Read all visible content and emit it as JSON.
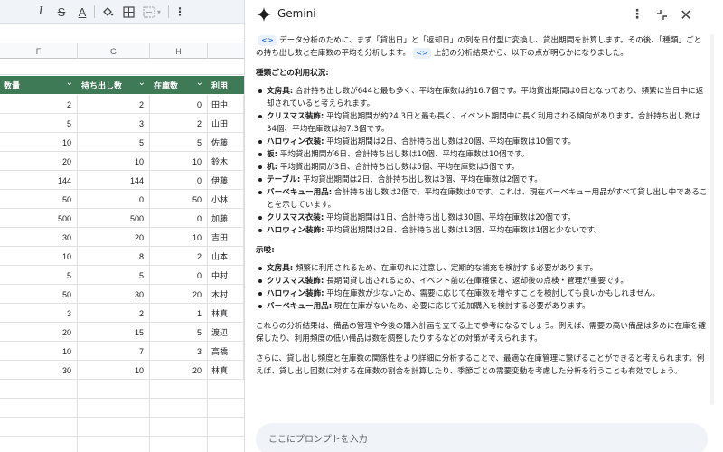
{
  "sheet": {
    "toolbar": {
      "icons": [
        "italic-icon",
        "strikethrough-icon",
        "text-color-icon",
        "fill-color-icon",
        "borders-icon",
        "merge-cells-icon",
        "more-vert-icon"
      ]
    },
    "columns": [
      "F",
      "G",
      "H",
      ""
    ],
    "headers": [
      "数量",
      "持ち出し数",
      "在庫数",
      "利用"
    ],
    "rows": [
      {
        "qty": "2",
        "out": "2",
        "stock": "0",
        "user": "田中"
      },
      {
        "qty": "5",
        "out": "3",
        "stock": "2",
        "user": "山田"
      },
      {
        "qty": "10",
        "out": "5",
        "stock": "5",
        "user": "佐藤"
      },
      {
        "qty": "20",
        "out": "10",
        "stock": "10",
        "user": "鈴木"
      },
      {
        "qty": "144",
        "out": "144",
        "stock": "0",
        "user": "伊藤"
      },
      {
        "qty": "50",
        "out": "0",
        "stock": "50",
        "user": "小林"
      },
      {
        "qty": "500",
        "out": "500",
        "stock": "0",
        "user": "加藤"
      },
      {
        "qty": "30",
        "out": "20",
        "stock": "10",
        "user": "吉田"
      },
      {
        "qty": "10",
        "out": "8",
        "stock": "2",
        "user": "山本"
      },
      {
        "qty": "5",
        "out": "5",
        "stock": "0",
        "user": "中村"
      },
      {
        "qty": "50",
        "out": "30",
        "stock": "20",
        "user": "木村"
      },
      {
        "qty": "3",
        "out": "2",
        "stock": "1",
        "user": "林真"
      },
      {
        "qty": "20",
        "out": "15",
        "stock": "5",
        "user": "渡辺"
      },
      {
        "qty": "10",
        "out": "7",
        "stock": "3",
        "user": "高橋"
      },
      {
        "qty": "30",
        "out": "10",
        "stock": "20",
        "user": "林真"
      }
    ]
  },
  "gemini": {
    "title": "Gemini",
    "header_icons": [
      "more-vert-icon",
      "collapse-icon",
      "close-icon"
    ],
    "intro_a": "データ分析のために、まず「貸出日」と「返却日」の列を日付型に変換し、貸出期間を計算します。その後、「種類」ごとの持ち出し数と在庫数の平均を分析します。",
    "intro_b": "上記の分析結果から、以下の点が明らかになりました。",
    "code_chip": "<>",
    "section1_title": "種類ごとの利用状況:",
    "section1_items": [
      {
        "label": "文房具:",
        "text": " 合計持ち出し数が644と最も多く、平均在庫数は約16.7個です。平均貸出期間は0日となっており、頻繁に当日中に返却されていると考えられます。"
      },
      {
        "label": "クリスマス装飾:",
        "text": " 平均貸出期間が約24.3日と最も長く、イベント期間中に長く利用される傾向があります。合計持ち出し数は34個、平均在庫数は約7.3個です。"
      },
      {
        "label": "ハロウィン衣装:",
        "text": " 平均貸出期間は2日、合計持ち出し数は20個、平均在庫数は10個です。"
      },
      {
        "label": "板:",
        "text": " 平均貸出期間が6日、合計持ち出し数は10個、平均在庫数は10個です。"
      },
      {
        "label": "机:",
        "text": " 平均貸出期間が3日、合計持ち出し数は5個、平均在庫数は5個です。"
      },
      {
        "label": "テーブル:",
        "text": " 平均貸出期間は2日、合計持ち出し数は3個、平均在庫数は2個です。"
      },
      {
        "label": "バーベキュー用品:",
        "text": " 合計持ち出し数は2個で、平均在庫数は0です。これは、現在バーベキュー用品がすべて貸し出し中であることを示しています。"
      },
      {
        "label": "クリスマス衣装:",
        "text": " 平均貸出期間は1日、合計持ち出し数は30個、平均在庫数は20個です。"
      },
      {
        "label": "ハロウィン装飾:",
        "text": " 平均貸出期間は2日、合計持ち出し数は13個、平均在庫数は1個と少ないです。"
      }
    ],
    "section2_title": "示唆:",
    "section2_items": [
      {
        "label": "文房具:",
        "text": " 頻繁に利用されるため、在庫切れに注意し、定期的な補充を検討する必要があります。"
      },
      {
        "label": "クリスマス装飾:",
        "text": " 長期間貸し出されるため、イベント前の在庫確保と、返却後の点検・管理が重要です。"
      },
      {
        "label": "ハロウィン装飾:",
        "text": " 平均在庫数が少ないため、需要に応じて在庫数を増やすことを検討しても良いかもしれません。"
      },
      {
        "label": "バーベキュー用品:",
        "text": " 現在在庫がないため、必要に応じて追加購入を検討する必要があります。"
      }
    ],
    "para3": "これらの分析結果は、備品の管理や今後の購入計画を立てる上で参考になるでしょう。例えば、需要の高い備品は多めに在庫を確保したり、利用頻度の低い備品は数を調整したりするなどの対策が考えられます。",
    "para4": "さらに、貸し出し頻度と在庫数の関係性をより詳細に分析することで、最適な在庫管理に繋げることができると考えられます。例えば、貸し出し回数に対する在庫数の割合を計算したり、季節ごとの需要変動を考慮した分析を行うことも有効でしょう。",
    "input_placeholder": "ここにプロンプトを入力"
  }
}
